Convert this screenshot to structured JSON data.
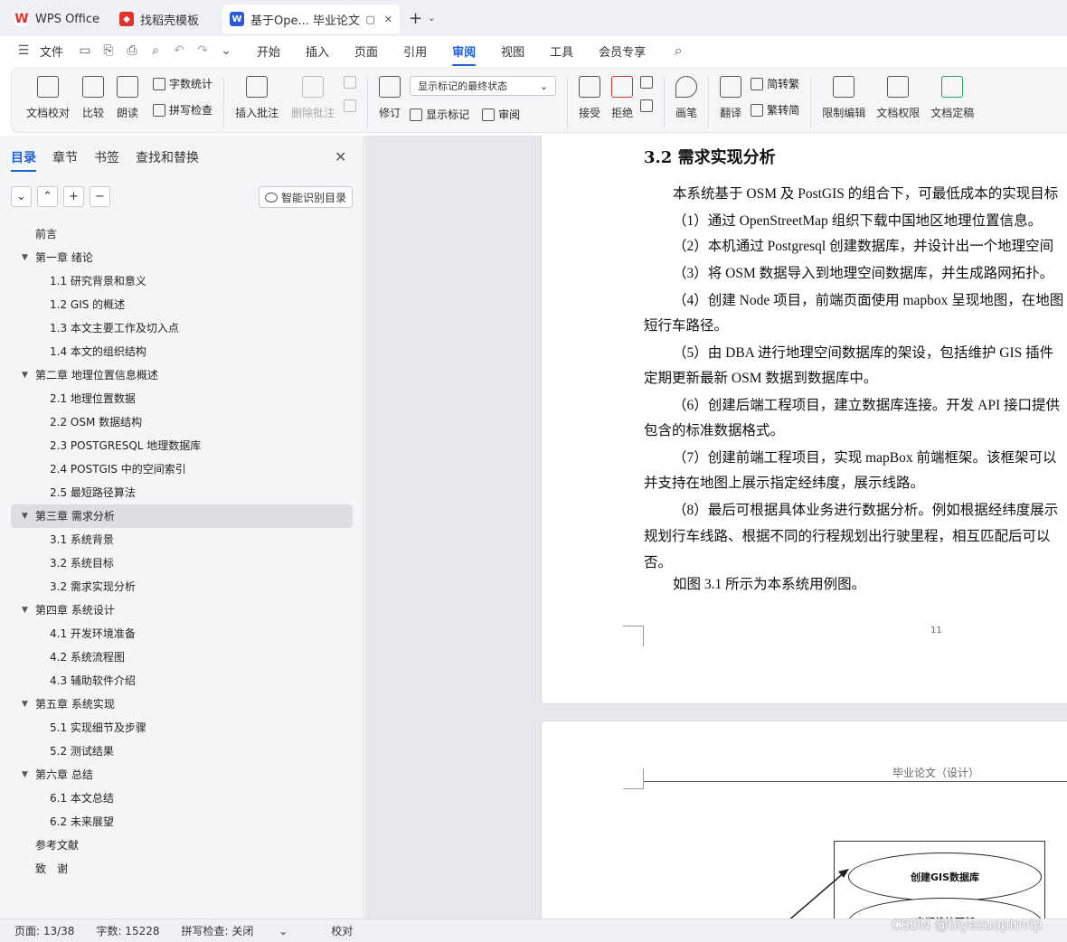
{
  "tabs": {
    "wps": "WPS Office",
    "templates": "找稻壳模板",
    "document": "基于Ope... 毕业论文",
    "new_tab": "+"
  },
  "menu": {
    "file": "文件",
    "tabs": [
      "开始",
      "插入",
      "页面",
      "引用",
      "审阅",
      "视图",
      "工具",
      "会员专享"
    ],
    "active_tab": "审阅"
  },
  "ribbon": {
    "proofread": "文档校对",
    "compare": "比较",
    "read_aloud": "朗读",
    "word_count": "字数统计",
    "spell_check": "拼写检查",
    "insert_comment": "插入批注",
    "delete_comment": "删除批注",
    "track_changes": "修订",
    "markup_state": "显示标记的最终状态",
    "show_markup": "显示标记",
    "review_pane": "审阅",
    "accept": "接受",
    "reject": "拒绝",
    "pen": "画笔",
    "translate": "翻译",
    "to_traditional": "简转繁",
    "to_simplified": "繁转简",
    "restrict_edit": "限制编辑",
    "doc_permission": "文档权限",
    "doc_finalize": "文档定稿"
  },
  "nav": {
    "tabs": [
      "目录",
      "章节",
      "书签",
      "查找和替换"
    ],
    "active_tab": "目录",
    "smart_toc": "智能识别目录",
    "toc": [
      {
        "label": "前言",
        "level": 0,
        "caret": false
      },
      {
        "label": "第一章 绪论",
        "level": 0,
        "caret": true
      },
      {
        "label": "1.1 研究背景和意义",
        "level": 1
      },
      {
        "label": "1.2 GIS 的概述",
        "level": 1
      },
      {
        "label": "1.3 本文主要工作及切入点",
        "level": 1
      },
      {
        "label": "1.4 本文的组织结构",
        "level": 1
      },
      {
        "label": "第二章 地理位置信息概述",
        "level": 0,
        "caret": true
      },
      {
        "label": "2.1 地理位置数据",
        "level": 1
      },
      {
        "label": "2.2 OSM 数据结构",
        "level": 1
      },
      {
        "label": "2.3 POSTGRESQL 地理数据库",
        "level": 1
      },
      {
        "label": "2.4 POSTGIS 中的空间索引",
        "level": 1
      },
      {
        "label": "2.5 最短路径算法",
        "level": 1
      },
      {
        "label": "第三章 需求分析",
        "level": 0,
        "caret": true,
        "selected": true
      },
      {
        "label": "3.1 系统背景",
        "level": 1
      },
      {
        "label": "3.2 系统目标",
        "level": 1
      },
      {
        "label": "3.2 需求实现分析",
        "level": 1
      },
      {
        "label": "第四章 系统设计",
        "level": 0,
        "caret": true
      },
      {
        "label": "4.1 开发环境准备",
        "level": 1
      },
      {
        "label": "4.2 系统流程图",
        "level": 1
      },
      {
        "label": "4.3 辅助软件介绍",
        "level": 1
      },
      {
        "label": "第五章 系统实现",
        "level": 0,
        "caret": true
      },
      {
        "label": "5.1 实现细节及步骤",
        "level": 1
      },
      {
        "label": "5.2 测试结果",
        "level": 1
      },
      {
        "label": "第六章 总结",
        "level": 0,
        "caret": true
      },
      {
        "label": "6.1 本文总结",
        "level": 1
      },
      {
        "label": "6.2 未来展望",
        "level": 1
      },
      {
        "label": "参考文献",
        "level": 0,
        "caret": false
      },
      {
        "label": "致　谢",
        "level": 0,
        "caret": false
      }
    ]
  },
  "document": {
    "heading": "3.2 需求实现分析",
    "lines": [
      "本系统基于 OSM 及 PostGIS 的组合下，可最低成本的实现目标",
      "（1）通过 OpenStreetMap 组织下载中国地区地理位置信息。",
      "（2）本机通过 Postgresql 创建数据库，并设计出一个地理空间",
      "（3）将 OSM 数据导入到地理空间数据库，并生成路网拓扑。",
      "（4）创建 Node 项目，前端页面使用 mapbox 呈现地图，在地图",
      "短行车路径。",
      "（5）由 DBA 进行地理空间数据库的架设，包括维护 GIS 插件",
      "定期更新最新 OSM 数据到数据库中。",
      "（6）创建后端工程项目，建立数据库连接。开发 API 接口提供",
      "包含的标准数据格式。",
      "（7）创建前端工程项目，实现 mapBox 前端框架。该框架可以",
      "并支持在地图上展示指定经纬度，展示线路。",
      "（8）最后可根据具体业务进行数据分析。例如根据经纬度展示",
      "规划行车线路、根据不同的行程规划出行驶里程，相互匹配后可以",
      "否。",
      "如图 3.1 所示为本系统用例图。"
    ],
    "page_number": "11",
    "header_text": "毕业论文（设计）",
    "diagram": {
      "node1": "创建GIS数据库",
      "node2": "定期维护更新"
    }
  },
  "status": {
    "page": "页面: 13/38",
    "words": "字数: 15228",
    "spell": "拼写检查: 关闭",
    "proof": "校对"
  },
  "watermark": "CSDN @biyezuopinvip",
  "colors": {
    "accent": "#1f5fd6",
    "wps_red": "#e0312b",
    "doc_blue": "#2b5ad8"
  }
}
